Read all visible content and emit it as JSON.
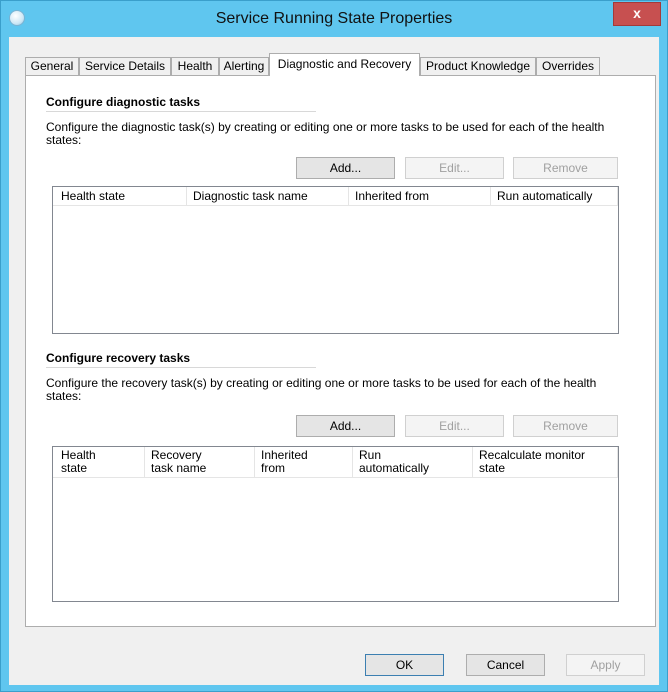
{
  "window": {
    "title": "Service Running State Properties",
    "close_glyph": "x"
  },
  "tabs": [
    {
      "label": "General"
    },
    {
      "label": "Service Details"
    },
    {
      "label": "Health"
    },
    {
      "label": "Alerting"
    },
    {
      "label": "Diagnostic and Recovery",
      "active": true
    },
    {
      "label": "Product Knowledge"
    },
    {
      "label": "Overrides"
    }
  ],
  "diagnostic": {
    "title": "Configure diagnostic tasks",
    "description": "Configure the diagnostic task(s) by creating or editing one or more tasks to be used for each of the health states:",
    "add_label": "Add...",
    "edit_label": "Edit...",
    "remove_label": "Remove",
    "columns": [
      "Health state",
      "Diagnostic task name",
      "Inherited from",
      "Run automatically"
    ]
  },
  "recovery": {
    "title": "Configure recovery tasks",
    "description": "Configure the recovery task(s) by creating or editing one or more tasks to be used for each of the health states:",
    "add_label": "Add...",
    "edit_label": "Edit...",
    "remove_label": "Remove",
    "columns": [
      "Health\nstate",
      "Recovery\ntask name",
      "Inherited\nfrom",
      "Run\nautomatically",
      "Recalculate monitor\nstate"
    ]
  },
  "footer": {
    "ok_label": "OK",
    "cancel_label": "Cancel",
    "apply_label": "Apply"
  }
}
